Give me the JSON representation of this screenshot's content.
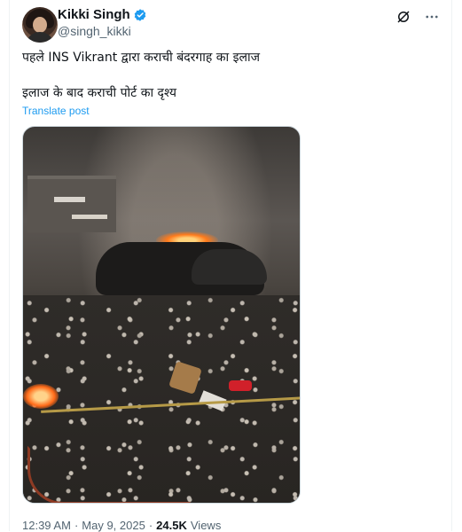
{
  "author": {
    "display_name": "Kikki Singh",
    "handle": "@singh_kikki",
    "verified_color": "#1d9bf0"
  },
  "post": {
    "line1": "पहले INS Vikrant द्वारा कराची बंदरगाह का इलाज",
    "line2": "इलाज के बाद कराची पोर्ट का दृश्य",
    "translate_label": "Translate post"
  },
  "meta": {
    "time": "12:39 AM",
    "sep": "·",
    "date": "May 9, 2025",
    "views_count": "24.5K",
    "views_label": "Views"
  },
  "icons": {
    "grok": "grok-icon",
    "more": "more-icon",
    "verified": "verified-badge-icon"
  },
  "colors": {
    "link": "#1d9bf0",
    "text": "#0f1419",
    "secondary": "#536471"
  }
}
